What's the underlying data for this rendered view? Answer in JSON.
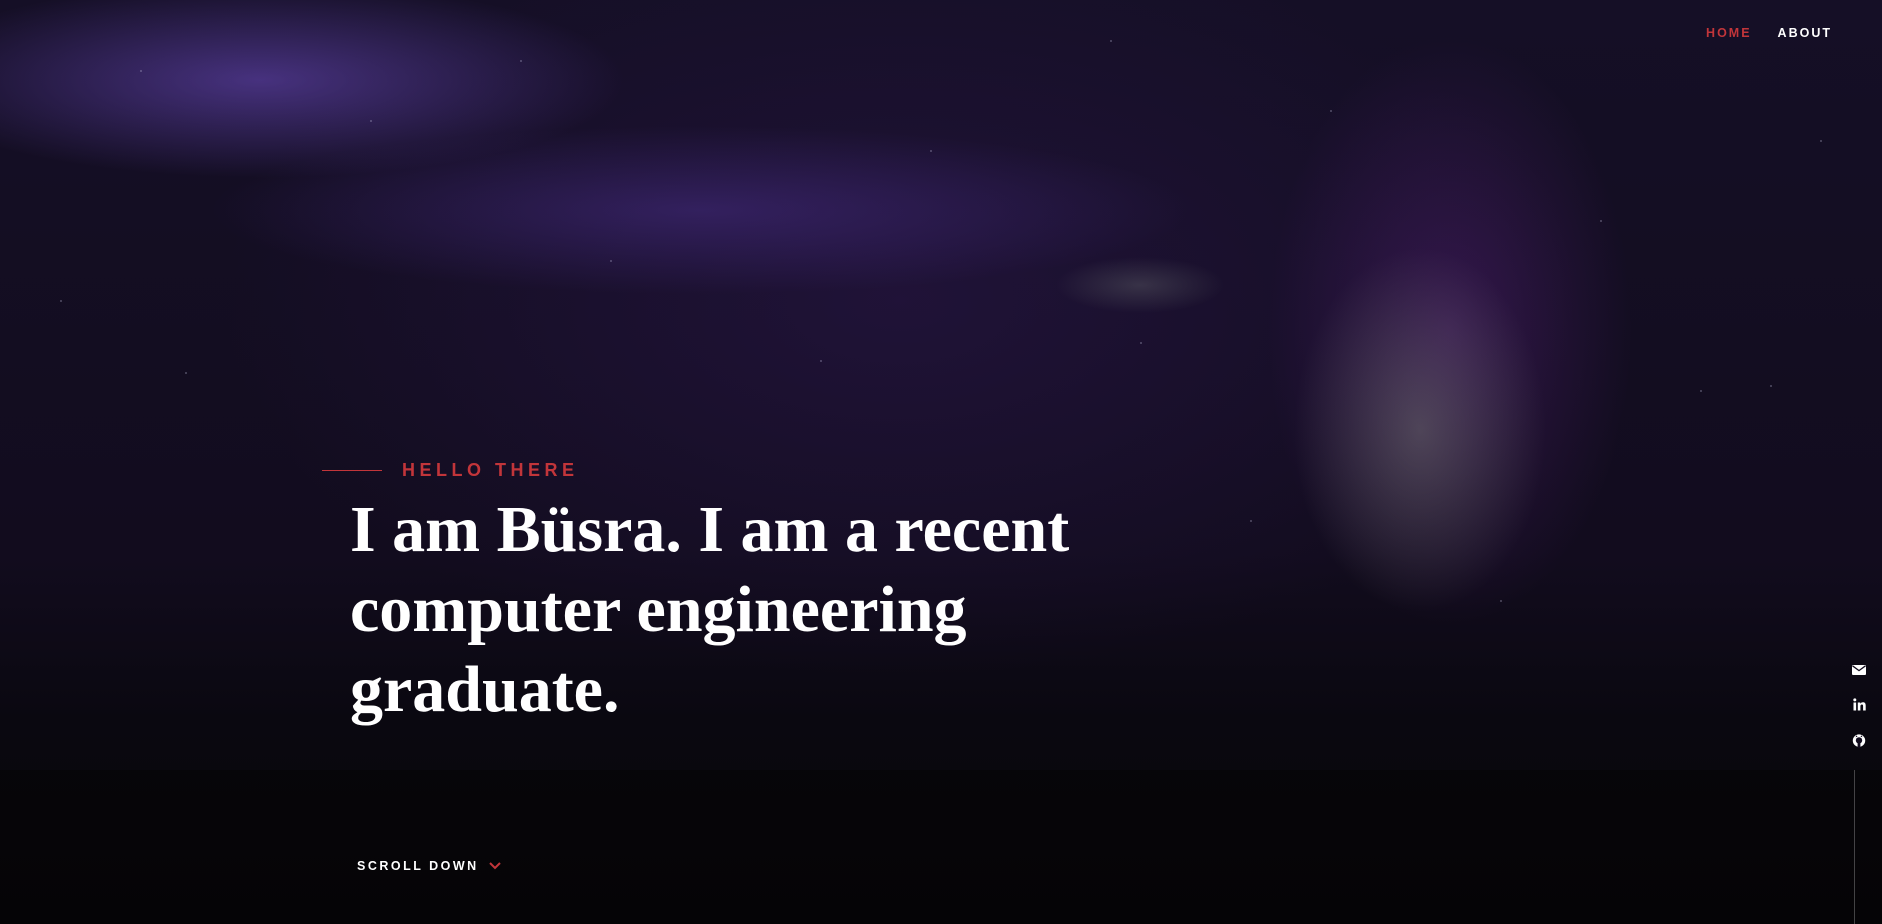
{
  "nav": {
    "items": [
      {
        "label": "HOME",
        "active": true
      },
      {
        "label": "ABOUT",
        "active": false
      }
    ]
  },
  "intro": {
    "kicker": "HELLO THERE",
    "headline": "I am Büsra. I am a recent computer engineering graduate."
  },
  "scroll": {
    "label": "SCROLL DOWN",
    "icon": "chevron-down-icon"
  },
  "social": [
    {
      "icon": "mail-icon"
    },
    {
      "icon": "linkedin-icon"
    },
    {
      "icon": "github-icon"
    }
  ],
  "colors": {
    "accent": "#c2353a",
    "text": "#ffffff",
    "background": "#120c1e"
  }
}
